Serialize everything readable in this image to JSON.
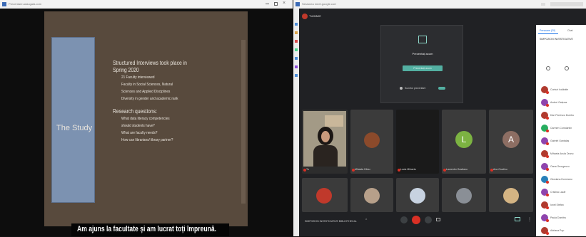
{
  "left_window": {
    "title_bar_text": "Prezentare.adaugata.com",
    "slide": {
      "heading": "The Study",
      "bullets": [
        {
          "text": "Structured Interviews took place in",
          "level": 1
        },
        {
          "text": "Spring 2020",
          "level": 1
        },
        {
          "text": "21 Faculty interviewed",
          "level": 2
        },
        {
          "text": "Faculty in Social Sciences, Natural",
          "level": 2
        },
        {
          "text": "Sciences and Applied Disciplines",
          "level": 2
        },
        {
          "text": "Diversity in gender and academic rank",
          "level": 2
        },
        {
          "text": "Research questions:",
          "level": 1
        },
        {
          "text": "What data literacy competencies",
          "level": 2
        },
        {
          "text": "should students have?",
          "level": 2
        },
        {
          "text": "What are faculty needs?",
          "level": 2
        },
        {
          "text": "How can librarians/ library partner?",
          "level": 2
        }
      ]
    },
    "subtitle": "Am ajuns la facultate și am lucrat toți împreună."
  },
  "right_window": {
    "title_bar_text": "Sesiunea meet.google.com",
    "tab_label": "TUIMMIE",
    "presentation_card": {
      "title": "Prezentați acum",
      "button_label": "Prezentați acum",
      "footer": "Sunetul prezentării"
    },
    "tiles": [
      {
        "name": "Tu",
        "type": "video"
      },
      {
        "name": "Mihaela Dănu",
        "type": "avatar",
        "color": "#8b4a2b"
      },
      {
        "name": "Lucia Mihaela",
        "type": "avatar",
        "color": "#2a2a2a"
      },
      {
        "name": "Laurentiu Gradianu",
        "type": "letter",
        "letter": "L",
        "color": "#7cb342"
      },
      {
        "name": "Ana Gradinu",
        "type": "letter",
        "letter": "A",
        "color": "#8d6e63"
      }
    ],
    "bottom_bar": {
      "meeting_name": "SIMPOZION INVESTIGATIVE BIBLIOTHECAL"
    },
    "side_panel": {
      "tabs": [
        "Persoane (20)",
        "Chat"
      ],
      "header": "SIMPOZION INVESTIGATIVE",
      "participants": [
        {
          "name": "Conturi hotărâte",
          "color": "#b03a2e"
        },
        {
          "name": "Andrei Gaițuna",
          "color": "#8e44ad"
        },
        {
          "name": "Dan Florescu Dumbu",
          "color": "#b03a2e"
        },
        {
          "name": "Carmen Constantin",
          "color": "#27ae60"
        },
        {
          "name": "Gabriel Gantalaș",
          "color": "#8e44ad"
        },
        {
          "name": "Mihaela Anula Dranu",
          "color": "#b03a2e"
        },
        {
          "name": "Oana Georgescu",
          "color": "#8e44ad"
        },
        {
          "name": "Giordana Dorneanu",
          "color": "#2980b9"
        },
        {
          "name": "Cristina Lazăr",
          "color": "#8e44ad"
        },
        {
          "name": "Ionel Stefan",
          "color": "#b03a2e"
        },
        {
          "name": "Paula Dumitru",
          "color": "#8e44ad"
        },
        {
          "name": "Adriana Pop",
          "color": "#b03a2e"
        }
      ]
    }
  }
}
